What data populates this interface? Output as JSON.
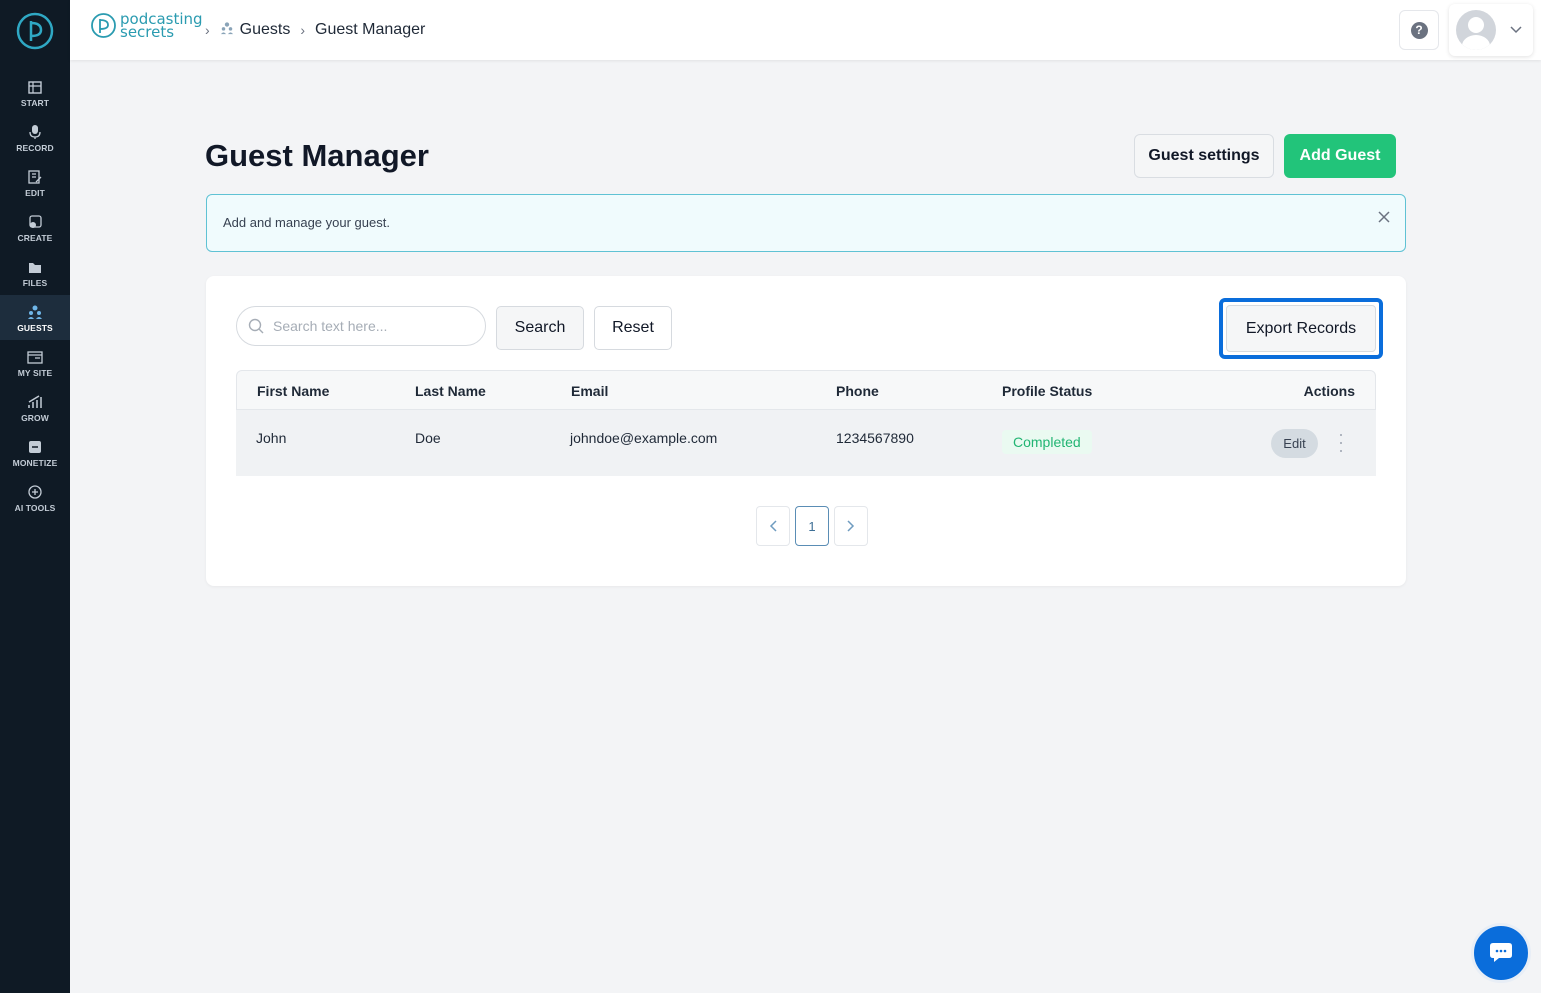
{
  "sidebar": {
    "items": [
      {
        "label": "START",
        "icon": "home-icon"
      },
      {
        "label": "RECORD",
        "icon": "microphone-icon"
      },
      {
        "label": "EDIT",
        "icon": "edit-icon"
      },
      {
        "label": "CREATE",
        "icon": "create-icon"
      },
      {
        "label": "FILES",
        "icon": "files-icon"
      },
      {
        "label": "GUESTS",
        "icon": "guests-icon",
        "active": true
      },
      {
        "label": "MY SITE",
        "icon": "site-icon"
      },
      {
        "label": "GROW",
        "icon": "grow-icon"
      },
      {
        "label": "MONETIZE",
        "icon": "monetize-icon"
      },
      {
        "label": "AI TOOLS",
        "icon": "ai-tools-icon"
      }
    ]
  },
  "brand": {
    "line1": "podcasting",
    "line2": "secrets"
  },
  "breadcrumb": {
    "guests": "Guests",
    "current": "Guest Manager"
  },
  "header": {
    "help_label": "?"
  },
  "page": {
    "title": "Guest Manager"
  },
  "actions": {
    "settings_label": "Guest settings",
    "add_label": "Add Guest"
  },
  "info": {
    "text": "Add and manage your guest."
  },
  "toolbar": {
    "search_placeholder": "Search text here...",
    "search_label": "Search",
    "reset_label": "Reset",
    "export_label": "Export Records"
  },
  "table": {
    "columns": [
      "First Name",
      "Last Name",
      "Email",
      "Phone",
      "Profile Status",
      "Actions"
    ],
    "rows": [
      {
        "first_name": "John",
        "last_name": "Doe",
        "email": "johndoe@example.com",
        "phone": "1234567890",
        "status": "Completed",
        "edit_label": "Edit"
      }
    ]
  },
  "pagination": {
    "current": "1"
  },
  "colors": {
    "accent": "#22c47a",
    "highlight": "#0a6ddb",
    "sidebar": "#0f1a25"
  }
}
